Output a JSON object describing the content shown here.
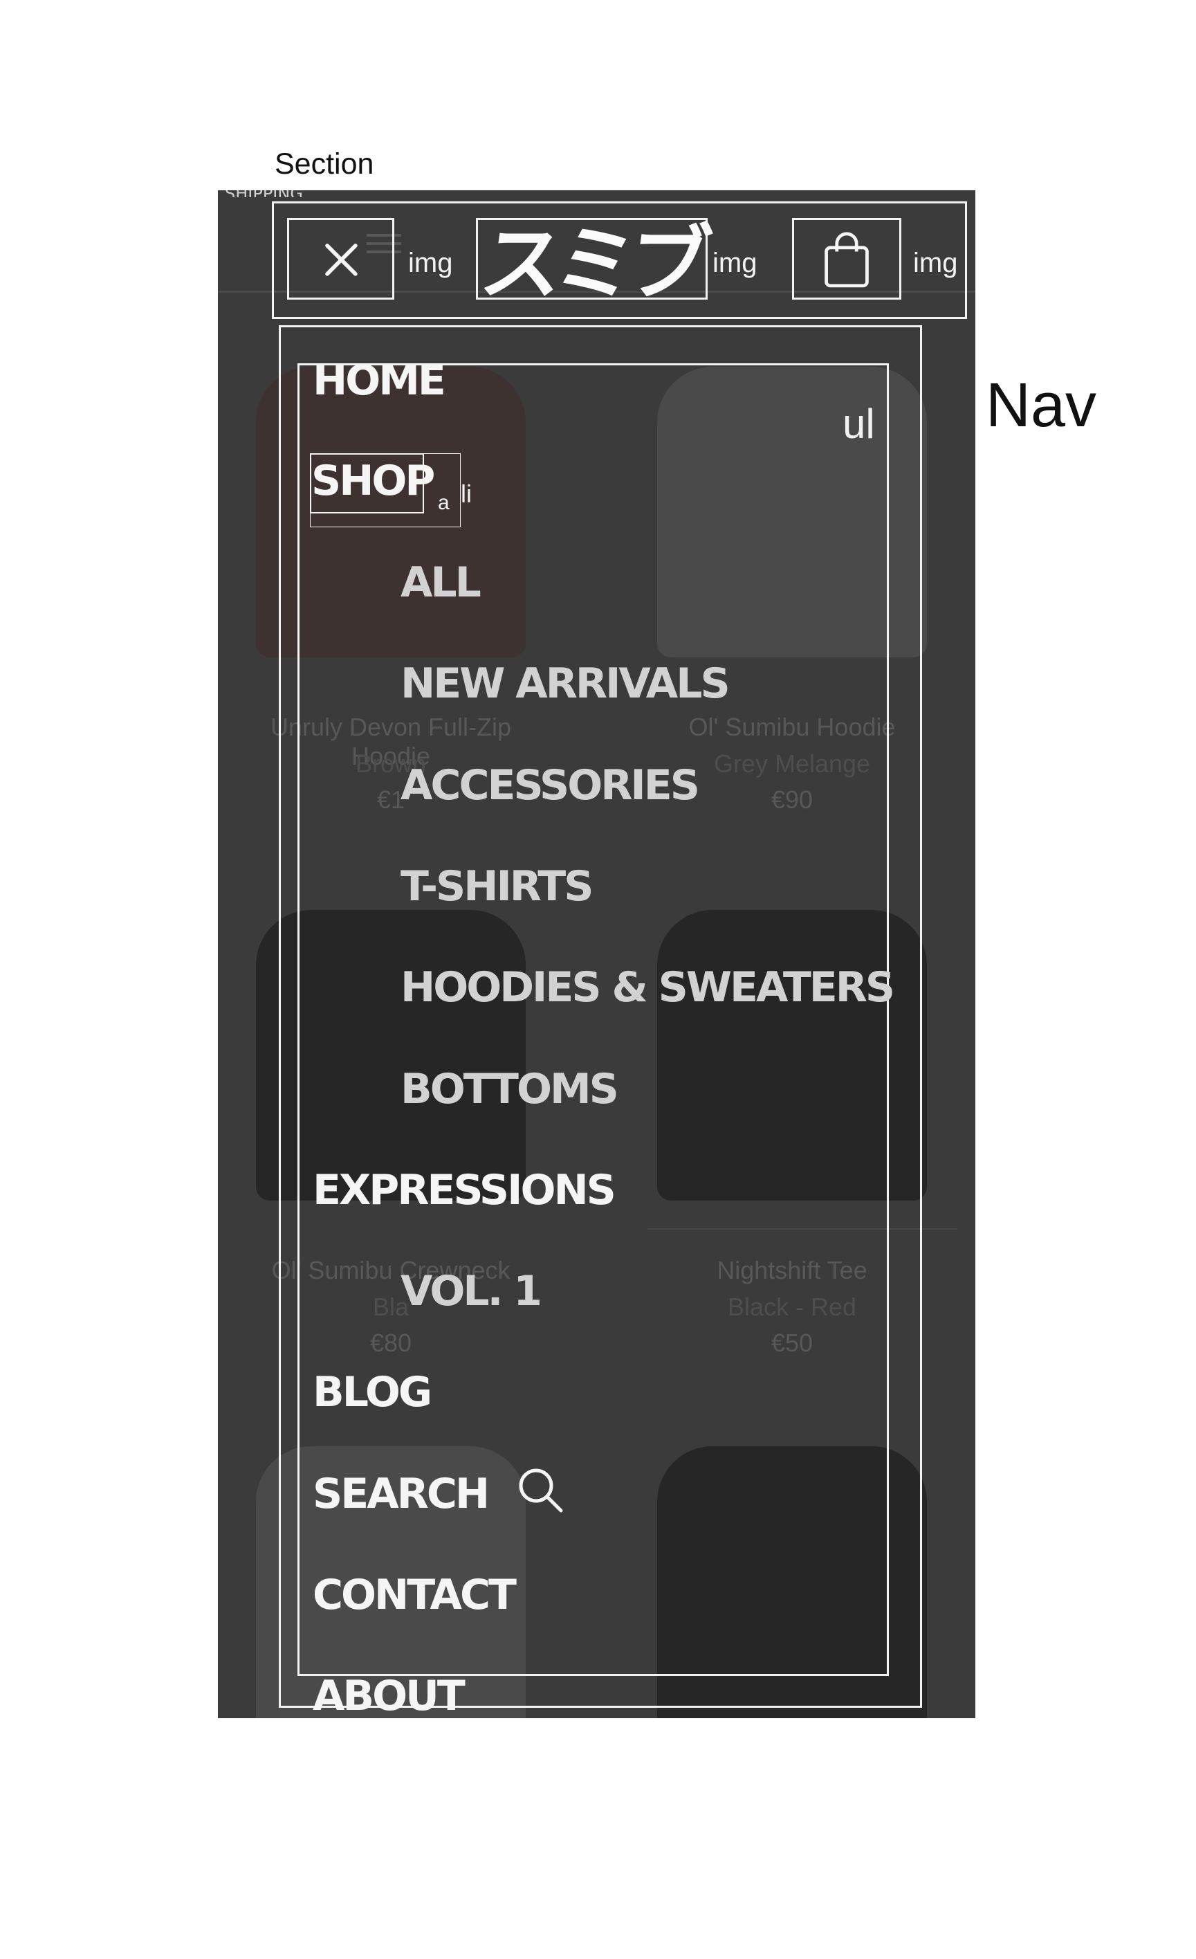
{
  "labels": {
    "section": "Section",
    "nav": "Nav",
    "img": "img",
    "ul": "ul",
    "li": "li",
    "a": "a"
  },
  "announcement": "SHIPPING",
  "header": {
    "logo_text": "スミブ",
    "close_icon": "close-icon",
    "cart_icon": "shopping-bag-icon"
  },
  "products": [
    {
      "name": "Unruly Devon Full-Zip Hoodie",
      "color": "Brown",
      "price": "€1"
    },
    {
      "name": "Ol' Sumibu Hoodie",
      "color": "Grey Melange",
      "price": "€90"
    },
    {
      "name": "Ol' Sumibu Crewneck",
      "color": "Bla",
      "price": "€80"
    },
    {
      "name": "Nightshift Tee",
      "color": "Black - Red",
      "price": "€50"
    },
    {
      "name": "",
      "color": "",
      "price": ""
    },
    {
      "name": "",
      "color": "",
      "price": ""
    }
  ],
  "menu": {
    "items": [
      {
        "label": "HOME"
      },
      {
        "label": "SHOP"
      },
      {
        "label": "ALL"
      },
      {
        "label": "NEW ARRIVALS"
      },
      {
        "label": "ACCESSORIES"
      },
      {
        "label": "T-SHIRTS"
      },
      {
        "label": "HOODIES & SWEATERS"
      },
      {
        "label": "BOTTOMS"
      },
      {
        "label": "EXPRESSIONS"
      },
      {
        "label": "VOL. 1"
      },
      {
        "label": "BLOG"
      },
      {
        "label": "SEARCH"
      },
      {
        "label": "CONTACT"
      },
      {
        "label": "ABOUT"
      }
    ],
    "search_icon": "search-icon"
  },
  "colors": {
    "overlay": "#3b3b3b",
    "menu_text": "#f5f5f5",
    "submenu_text": "#d2d2d2"
  }
}
